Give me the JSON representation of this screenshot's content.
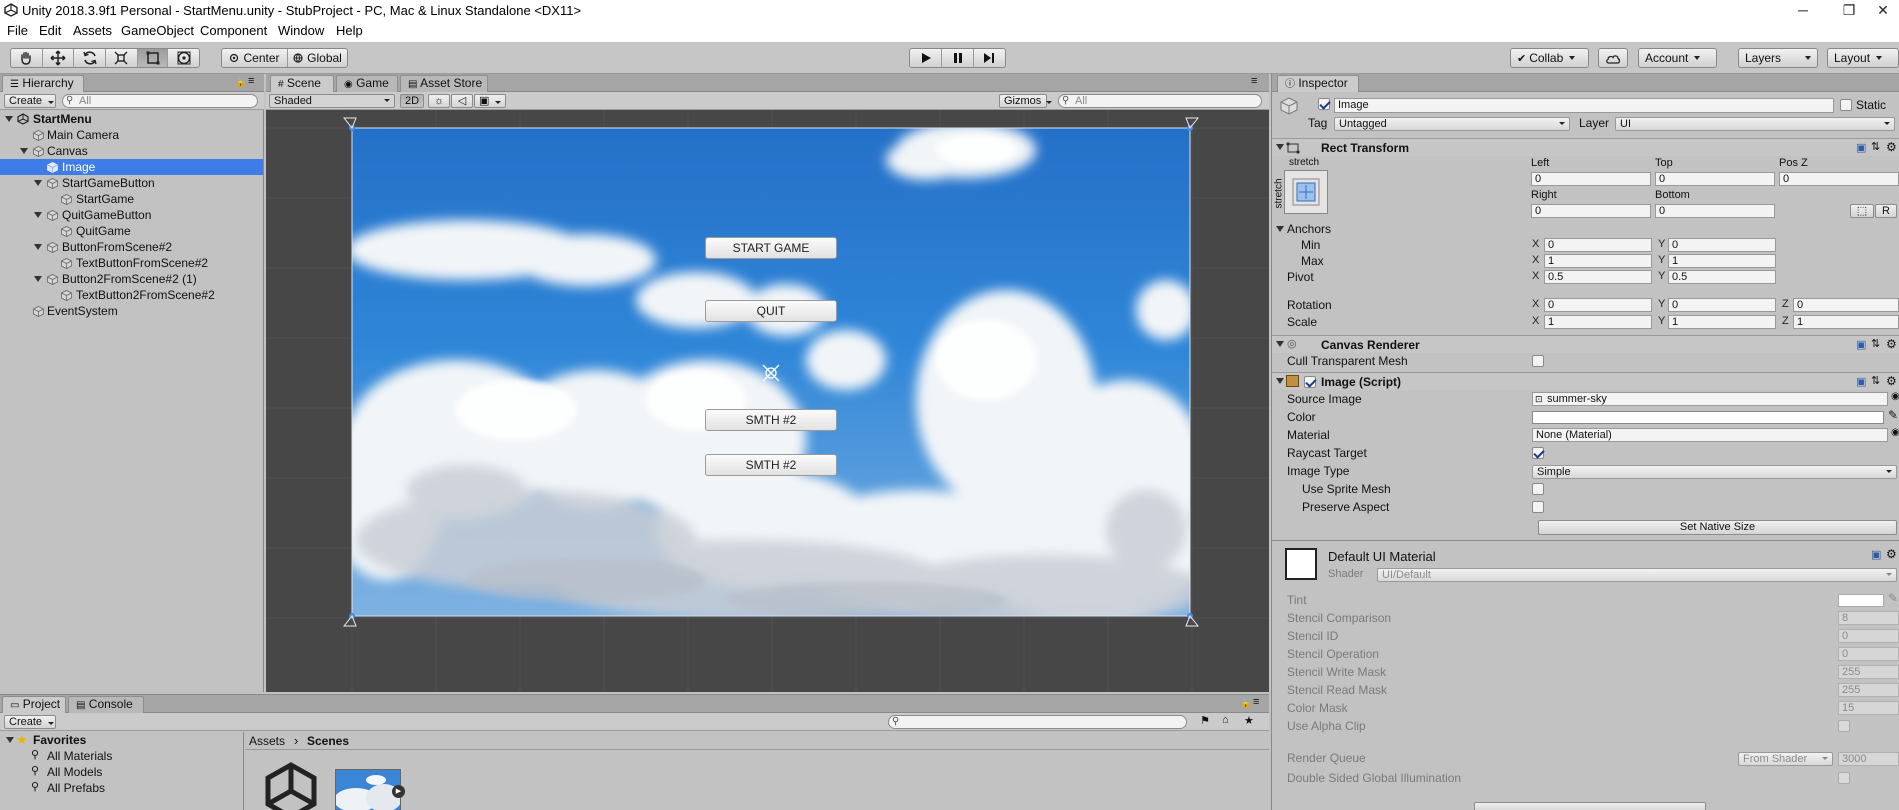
{
  "window": {
    "title": "Unity 2018.3.9f1 Personal - StartMenu.unity - StubProject - PC, Mac & Linux Standalone <DX11>",
    "minimize": "─",
    "maximize": "❐",
    "close": "✕"
  },
  "menu": [
    "File",
    "Edit",
    "Assets",
    "GameObject",
    "Component",
    "Window",
    "Help"
  ],
  "toolbar": {
    "pivot": "Center",
    "space": "Global",
    "collab": "Collab",
    "account": "Account",
    "layers": "Layers",
    "layout": "Layout"
  },
  "hierarchy": {
    "tab": "Hierarchy",
    "create": "Create",
    "search_placeholder": "All",
    "scene": "StartMenu",
    "items": [
      {
        "label": "Main Camera"
      },
      {
        "label": "Canvas"
      },
      {
        "label": "Image"
      },
      {
        "label": "StartGameButton"
      },
      {
        "label": "StartGame"
      },
      {
        "label": "QuitGameButton"
      },
      {
        "label": "QuitGame"
      },
      {
        "label": "ButtonFromScene#2"
      },
      {
        "label": "TextButtonFromScene#2"
      },
      {
        "label": "Button2FromScene#2 (1)"
      },
      {
        "label": "TextButton2FromScene#2"
      },
      {
        "label": "EventSystem"
      }
    ]
  },
  "scene": {
    "tabs": [
      "Scene",
      "Game",
      "Asset Store"
    ],
    "shading": "Shaded",
    "mode2d": "2D",
    "gizmos": "Gizmos",
    "search_placeholder": "All",
    "buttons": [
      "START GAME",
      "QUIT",
      "SMTH #2",
      "SMTH #2"
    ]
  },
  "inspector": {
    "tab": "Inspector",
    "object_name": "Image",
    "static_label": "Static",
    "tag_label": "Tag",
    "tag_value": "Untagged",
    "layer_label": "Layer",
    "layer_value": "UI",
    "rect_transform": {
      "title": "Rect Transform",
      "stretch": "stretch",
      "left_label": "Left",
      "left": "0",
      "top_label": "Top",
      "top": "0",
      "posz_label": "Pos Z",
      "posz": "0",
      "right_label": "Right",
      "right": "0",
      "bottom_label": "Bottom",
      "bottom": "0",
      "anchors_label": "Anchors",
      "min_label": "Min",
      "min_x": "0",
      "min_y": "0",
      "max_label": "Max",
      "max_x": "1",
      "max_y": "1",
      "pivot_label": "Pivot",
      "pivot_x": "0.5",
      "pivot_y": "0.5",
      "rotation_label": "Rotation",
      "rot_x": "0",
      "rot_y": "0",
      "rot_z": "0",
      "scale_label": "Scale",
      "scale_x": "1",
      "scale_y": "1",
      "scale_z": "1",
      "r_button": "R"
    },
    "canvas_renderer": {
      "title": "Canvas Renderer",
      "cull_label": "Cull Transparent Mesh"
    },
    "image_script": {
      "title": "Image (Script)",
      "source_label": "Source Image",
      "source_value": "summer-sky",
      "color_label": "Color",
      "material_label": "Material",
      "material_value": "None (Material)",
      "raycast_label": "Raycast Target",
      "type_label": "Image Type",
      "type_value": "Simple",
      "sprite_mesh_label": "Use Sprite Mesh",
      "preserve_label": "Preserve Aspect",
      "native_size": "Set Native Size"
    },
    "material": {
      "title": "Default UI Material",
      "shader_label": "Shader",
      "shader_value": "UI/Default",
      "tint_label": "Tint",
      "stencil_comp_label": "Stencil Comparison",
      "stencil_comp": "8",
      "stencil_id_label": "Stencil ID",
      "stencil_id": "0",
      "stencil_op_label": "Stencil Operation",
      "stencil_op": "0",
      "stencil_write_label": "Stencil Write Mask",
      "stencil_write": "255",
      "stencil_read_label": "Stencil Read Mask",
      "stencil_read": "255",
      "color_mask_label": "Color Mask",
      "color_mask": "15",
      "alpha_clip_label": "Use Alpha Clip",
      "render_queue_label": "Render Queue",
      "render_queue_mode": "From Shader",
      "render_queue": "3000",
      "dsgi_label": "Double Sided Global Illumination"
    }
  },
  "project": {
    "tabs": [
      "Project",
      "Console"
    ],
    "create": "Create",
    "favorites": "Favorites",
    "fav_items": [
      "All Materials",
      "All Models",
      "All Prefabs"
    ],
    "breadcrumb": [
      "Assets",
      "Scenes"
    ]
  },
  "colors": {
    "selection": "#3e7de7",
    "panel": "#c2c2c2",
    "viewport": "#474747",
    "sky": "#2f7fd0"
  }
}
